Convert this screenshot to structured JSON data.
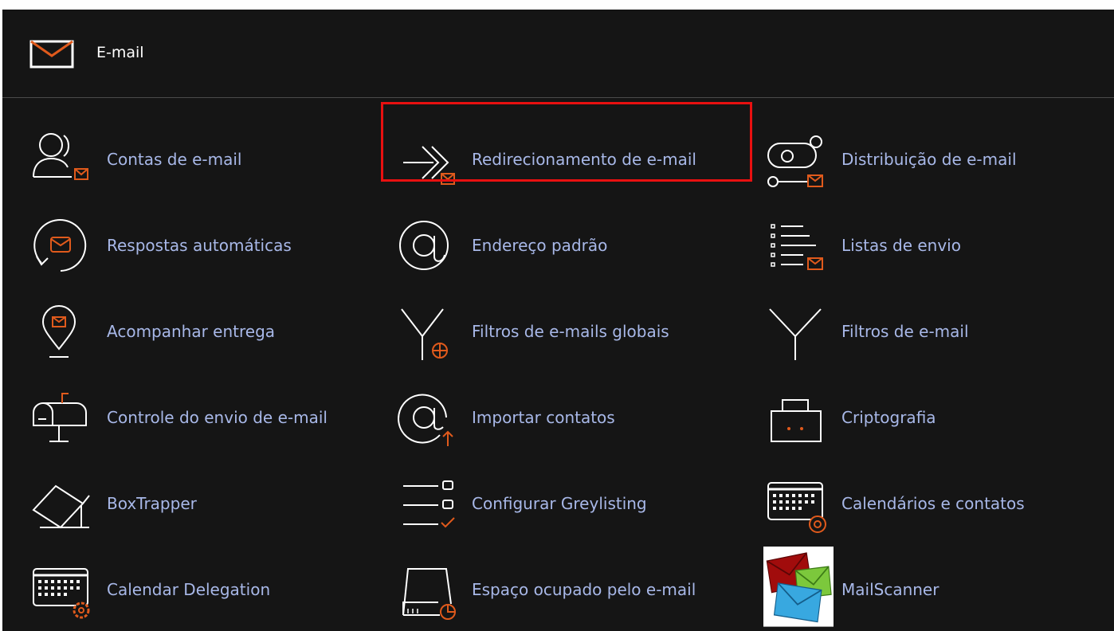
{
  "header": {
    "title": "E-mail",
    "icon": "envelope-icon"
  },
  "colors": {
    "background": "#151515",
    "link": "#a8b8e8",
    "accent": "#e05a1c",
    "highlight": "#e81010"
  },
  "items": [
    {
      "label": "Contas de e-mail",
      "icon": "email-accounts-icon"
    },
    {
      "label": "Redirecionamento de e-mail",
      "icon": "forwarders-icon"
    },
    {
      "label": "Distribuição de e-mail",
      "icon": "email-routing-icon"
    },
    {
      "label": "Respostas automáticas",
      "icon": "autoresponders-icon"
    },
    {
      "label": "Endereço padrão",
      "icon": "default-address-icon"
    },
    {
      "label": "Listas de envio",
      "icon": "mailing-lists-icon"
    },
    {
      "label": "Acompanhar entrega",
      "icon": "track-delivery-icon"
    },
    {
      "label": "Filtros de e-mails globais",
      "icon": "global-filters-icon"
    },
    {
      "label": "Filtros de e-mail",
      "icon": "email-filters-icon"
    },
    {
      "label": "Controle do envio de e-mail",
      "icon": "deliverability-icon"
    },
    {
      "label": "Importar contatos",
      "icon": "import-contacts-icon"
    },
    {
      "label": "Criptografia",
      "icon": "encryption-icon"
    },
    {
      "label": "BoxTrapper",
      "icon": "boxtrapper-icon"
    },
    {
      "label": "Configurar Greylisting",
      "icon": "greylisting-icon"
    },
    {
      "label": "Calendários e contatos",
      "icon": "calendars-contacts-icon"
    },
    {
      "label": "Calendar Delegation",
      "icon": "calendar-delegation-icon"
    },
    {
      "label": "Espaço ocupado pelo e-mail",
      "icon": "disk-usage-icon"
    },
    {
      "label": "MailScanner",
      "icon": "mailscanner-icon"
    }
  ]
}
